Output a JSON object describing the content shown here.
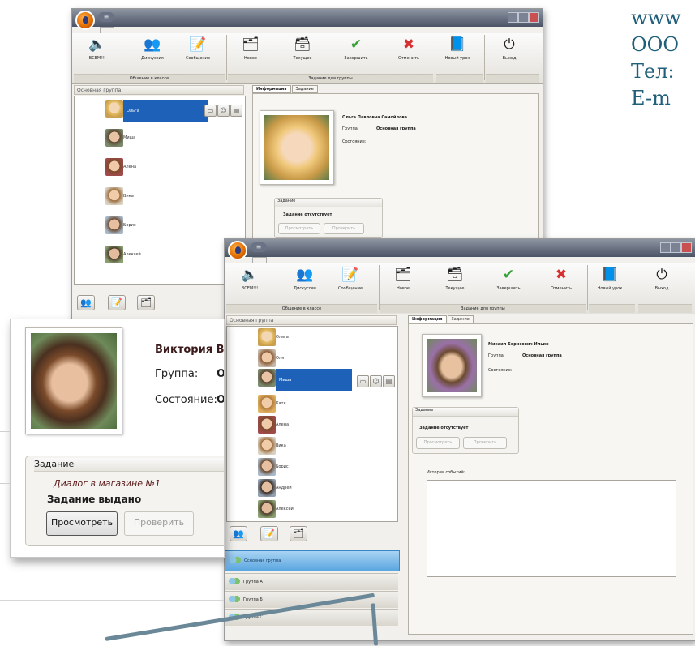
{
  "contact_lines": [
    "www",
    "ООО",
    "Тел:",
    "E-m"
  ],
  "window": {
    "qbtn": "≡",
    "ribbon": {
      "buttons": [
        {
          "label": "ВСЕМ!!!",
          "icon": "speaker-icon"
        },
        {
          "label": "Дискуссия",
          "icon": "people-icon"
        },
        {
          "label": "Сообщение",
          "icon": "note-icon"
        },
        {
          "label": "Новое",
          "icon": "new-task-icon"
        },
        {
          "label": "Текущее",
          "icon": "current-task-icon"
        },
        {
          "label": "Завершить",
          "icon": "check-icon"
        },
        {
          "label": "Отменить",
          "icon": "x-icon"
        },
        {
          "label": "Новый урок",
          "icon": "book-icon"
        },
        {
          "label": "Выход",
          "icon": "exit-icon"
        }
      ],
      "groups": [
        "Общение в классе",
        "Задание для группы"
      ]
    },
    "pane_title": "Основная группа",
    "tabs": [
      "Информация",
      "Задание"
    ],
    "group_label": "Группа:",
    "state_label": "Состояние:",
    "task_header": "Задание",
    "no_task": "Задание отсутствует",
    "btn_view": "Просмотреть",
    "btn_check": "Проверить"
  },
  "win1": {
    "students": [
      "Ольга",
      "Миша",
      "Алена",
      "Вика",
      "Борис",
      "Алексей"
    ],
    "selected_index": 0,
    "student_name": "Ольга Павловна Самойлова",
    "group_value": "Основная группа"
  },
  "win2": {
    "students": [
      "Ольга",
      "Оля",
      "Миша",
      "Катя",
      "Алена",
      "Вика",
      "Борис",
      "Андрей",
      "Алексей"
    ],
    "selected_index": 2,
    "student_name": "Михаил Борисович Ильин",
    "group_value": "Основная группа",
    "history_label": "История событий:",
    "groups": [
      "Основная группа",
      "Группа А",
      "Группа Б",
      "Группа С"
    ]
  },
  "zoom": {
    "name": "Виктория Влад",
    "group_label": "Группа:",
    "group_value": "Ос",
    "state_label": "Состояние:",
    "state_value": "О:",
    "task_header": "Задание",
    "task_title": "Диалог в магазине №1",
    "task_status": "Задание выдано",
    "btn_view": "Просмотреть",
    "btn_check": "Проверить"
  },
  "colors": {
    "selection": "#1d62b8",
    "accent_text": "#1f5f7a",
    "callout": "#6a8898"
  }
}
